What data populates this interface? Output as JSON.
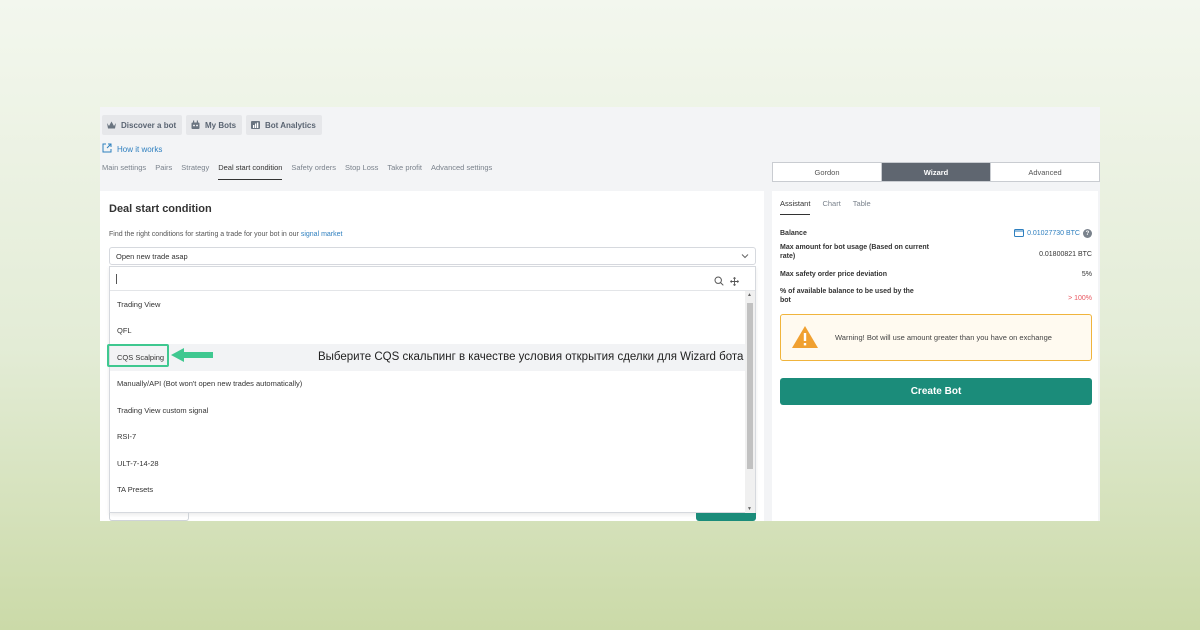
{
  "nav": {
    "discover": "Discover a bot",
    "mybots": "My Bots",
    "analytics": "Bot Analytics",
    "how": "How it works"
  },
  "tabs": [
    "Main settings",
    "Pairs",
    "Strategy",
    "Deal start condition",
    "Safety orders",
    "Stop Loss",
    "Take profit",
    "Advanced settings"
  ],
  "deal": {
    "title": "Deal start condition",
    "hint_text": "Find the right conditions for starting a trade for your bot in our",
    "hint_link": "signal market",
    "select_value": "Open new trade asap",
    "options": [
      "Trading View",
      "QFL",
      "CQS Scalping",
      "Manually/API (Bot won't open new trades automatically)",
      "Trading View custom signal",
      "RSI-7",
      "ULT-7-14-28",
      "TA Presets"
    ]
  },
  "annotation": "Выберите CQS скальпинг в качестве условия открытия сделки для Wizard бота",
  "modes": [
    "Gordon",
    "Wizard",
    "Advanced"
  ],
  "right_tabs": [
    "Assistant",
    "Chart",
    "Table"
  ],
  "balance": {
    "balance_label": "Balance",
    "balance_value": "0.01027730 BTC",
    "max_label": "Max amount for bot usage (Based on current rate)",
    "max_value": "0.01800821 BTC",
    "dev_label": "Max safety order price deviation",
    "dev_value": "5%",
    "pct_label": "% of available balance to be used by the bot",
    "pct_value": "> 100%"
  },
  "warning": "Warning! Bot will use amount greater than you have on exchange",
  "create_label": "Create Bot",
  "colors": {
    "accent": "#1b8c7a",
    "highlight": "#3fc890",
    "link": "#2e7fbf",
    "danger": "#e8565f",
    "warning": "#f0a030"
  }
}
